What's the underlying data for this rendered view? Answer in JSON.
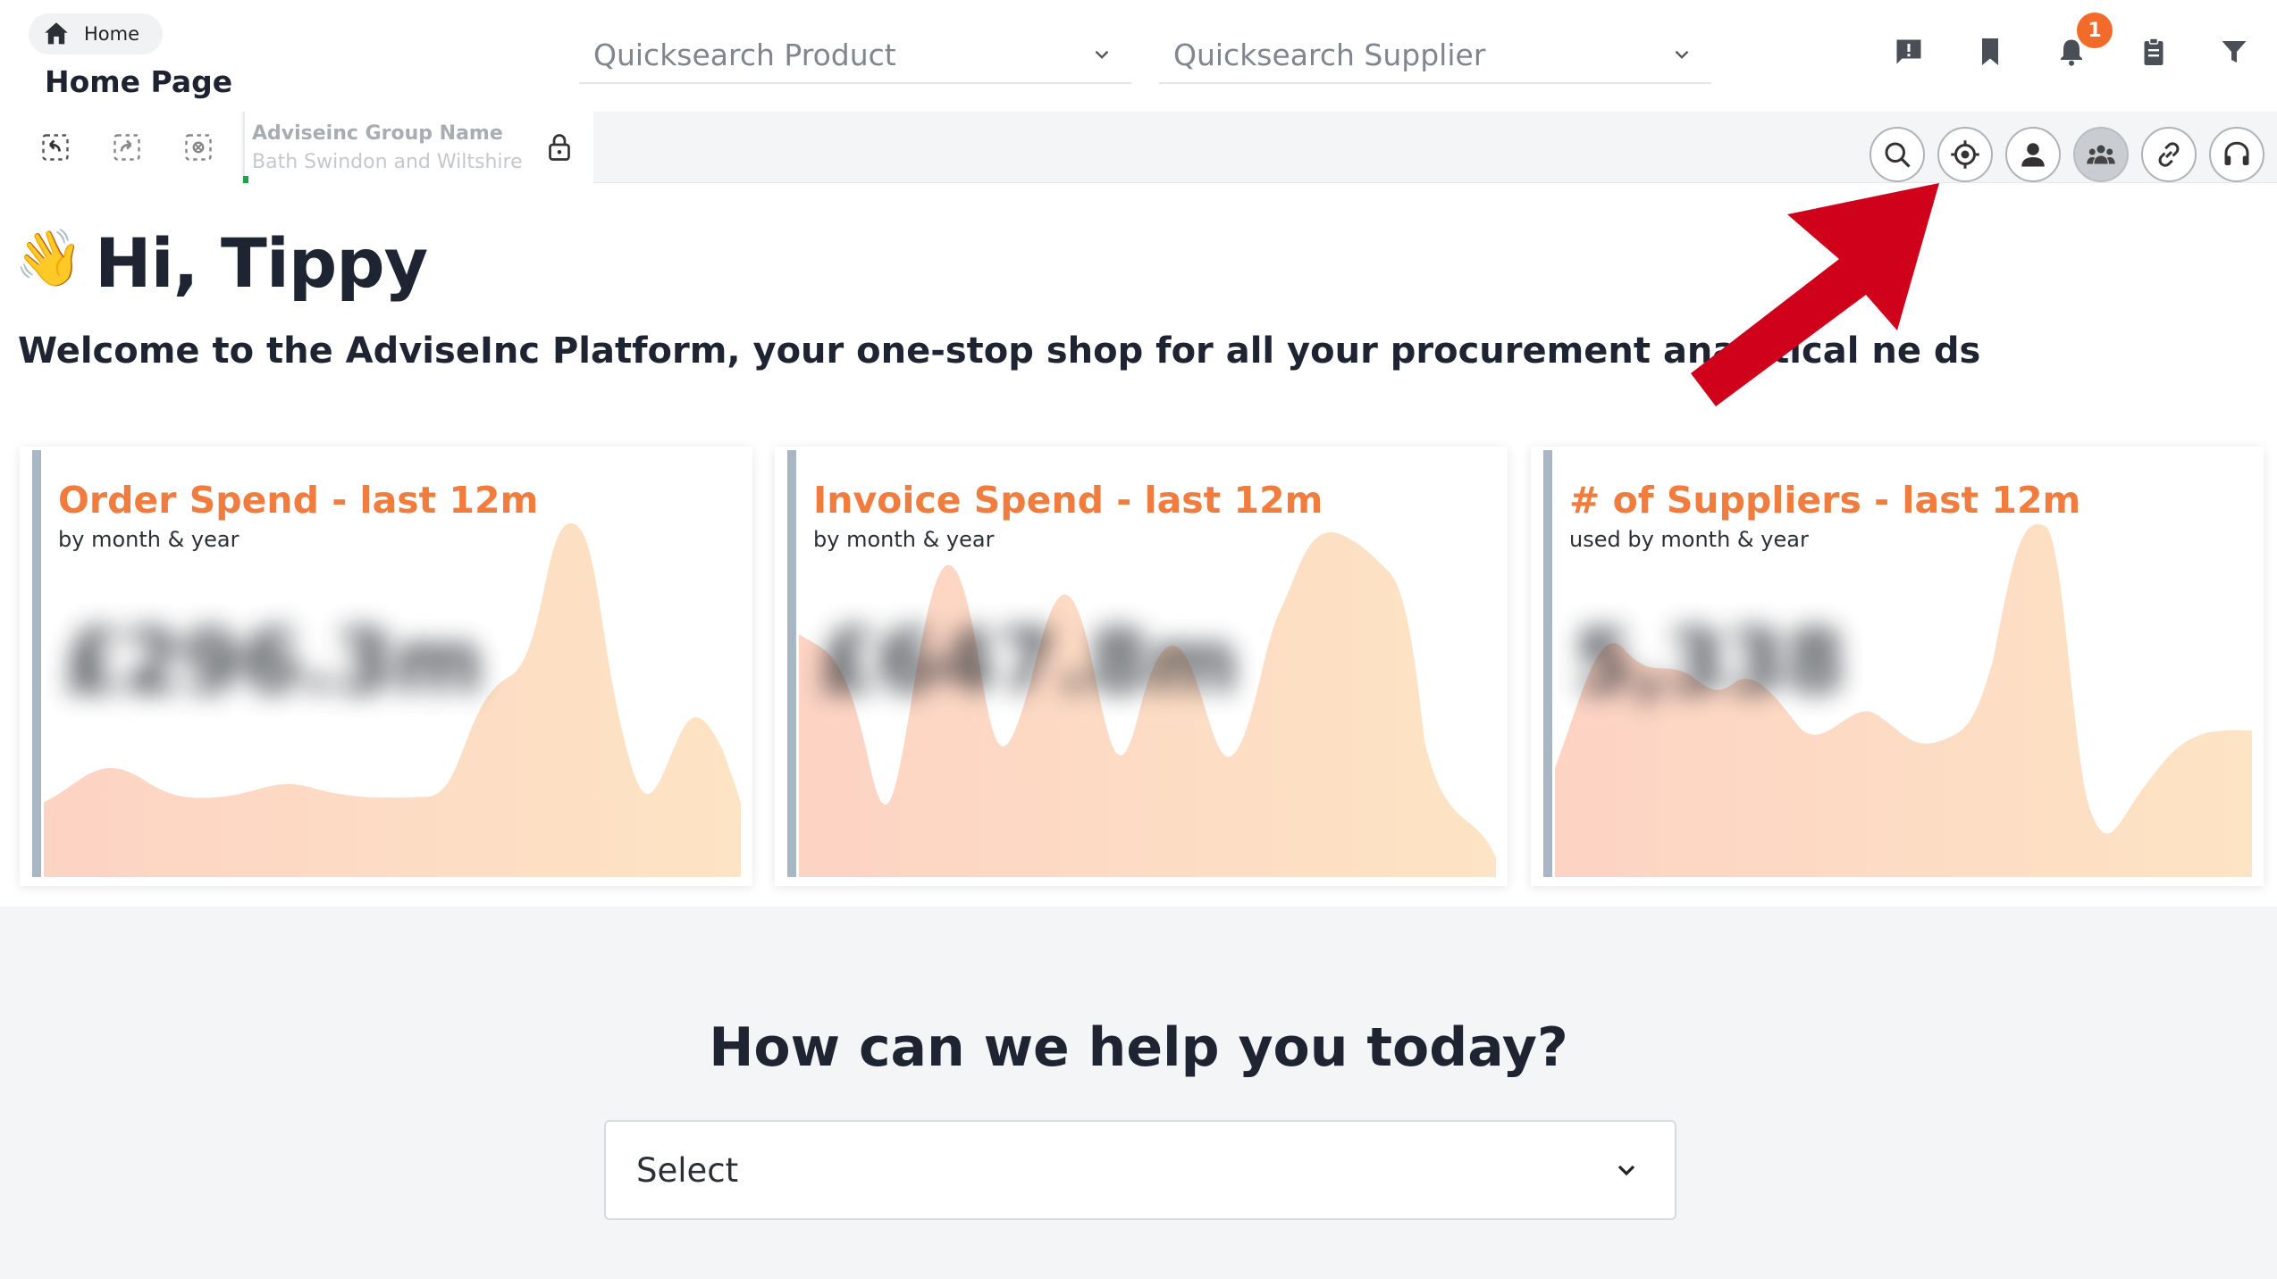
{
  "header": {
    "breadcrumb": "Home",
    "page_title": "Home Page",
    "quicksearch_product_placeholder": "Quicksearch Product",
    "quicksearch_supplier_placeholder": "Quicksearch Supplier",
    "notification_count": "1",
    "icons": [
      "feedback-icon",
      "bookmark-icon",
      "bell-icon",
      "clipboard-icon",
      "filter-icon"
    ]
  },
  "toolbar": {
    "group_name": "Adviseinc Group Name",
    "group_sub": "Bath Swindon and Wiltshire",
    "left_icons": [
      "undo-icon",
      "redo-icon",
      "clear-icon"
    ],
    "ring_icons": [
      "search-icon",
      "target-icon",
      "person-icon",
      "group-icon",
      "link-icon",
      "headset-icon"
    ]
  },
  "greeting": {
    "wave": "👋",
    "hi": "Hi, Tippy",
    "welcome": "Welcome to the AdviseInc Platform, your one-stop shop for all your procurement analytical ne ds"
  },
  "cards": [
    {
      "title": "Order Spend - last 12m",
      "subtitle": "by month & year",
      "metric": "£296.3m"
    },
    {
      "title": "Invoice Spend - last 12m",
      "subtitle": "by month & year",
      "metric": "£647.8m"
    },
    {
      "title": "# of Suppliers - last 12m",
      "subtitle": "used by month & year",
      "metric": "5,338"
    }
  ],
  "help": {
    "title": "How can we help you today?",
    "select_value": "Select"
  },
  "colors": {
    "accent_orange": "#f07c3e",
    "badge": "#f26b2b",
    "annotation_arrow": "#d0021b"
  }
}
